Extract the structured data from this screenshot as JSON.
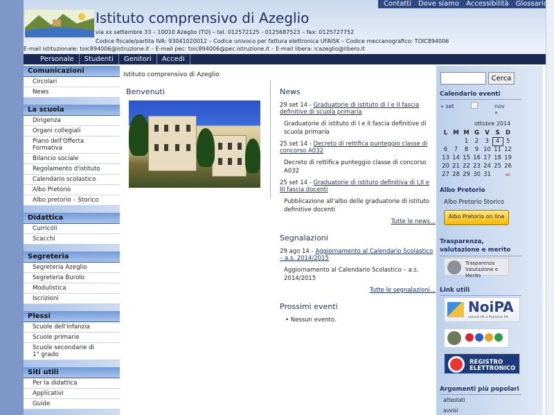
{
  "header": {
    "toplinks": [
      "Contatti",
      "Dove siamo",
      "Accessibilità",
      "Glossario"
    ],
    "title": "Istituto comprensivo di Azeglio",
    "address": "via xx settembre 33 – 10010 Azeglio (TO)   –  tel. 012572125 - 0125687523  –  fax: 0125727752",
    "codes": "Codice fiscale/partita IVA:  93041020012   –  Codice univoco per fattura elettronica UFAI5K   –  Codice meccanografico:  TOIC894006",
    "emails": "E-mail istituzionale: toic894006@istruzione.it   –  E-mail pec: toic894006@pec.istruzione.it  –  E-mail libera: icazeglio@libero.it"
  },
  "nav": [
    "Personale",
    "Studenti",
    "Genitori",
    "Accedi"
  ],
  "sidebar": [
    {
      "title": "Comunicazioni",
      "items": [
        "Circolari",
        "News"
      ]
    },
    {
      "title": "La scuola",
      "items": [
        "Dirigenza",
        "Organi collegiali",
        "Piano dell'Offerta Formativa",
        "Bilancio sociale",
        "Regolamento d'istituto",
        "Calendario scolastico",
        "Albo Pretorio",
        "Albo pretorio – Storico"
      ]
    },
    {
      "title": "Didattica",
      "items": [
        "Curricoli",
        "Scacchi"
      ]
    },
    {
      "title": "Segreteria",
      "items": [
        "Segreteria Azeglio",
        "Segreteria Burolo",
        "Modulistica",
        "Iscrizioni"
      ]
    },
    {
      "title": "Plessi",
      "items": [
        "Scuole dell'infanzia",
        "Scuole primarie",
        "Scuole secondarie di 1° grado"
      ]
    },
    {
      "title": "Siti utili",
      "items": [
        "Per la didattica",
        "Applicativi",
        "Guide"
      ]
    }
  ],
  "main": {
    "breadcrumb": "Istituto comprensivo di Azeglio",
    "welcome_title": "Benvenuti",
    "news_title": "News",
    "news": [
      {
        "date": "29 set 14 - ",
        "link": "Graduatorie di istituto di I e II fascia definitive di scuola primaria",
        "desc": "Graduatorie di istituto di I e II fascia definitive di scuola primaria"
      },
      {
        "date": "25 set 14 - ",
        "link": "Decreto di rettifica punteggio classe di concorso A032",
        "desc": "Decreto di rettifica punteggio classe di concorso A032"
      },
      {
        "date": "25 set 14 - ",
        "link": "Graduatorie di istituto definitiva di I,II e III fascia docenti",
        "desc": "Pubblicazione all'albo delle graduatorie di istituto definitive docenti"
      }
    ],
    "news_more": "Tutte le news...",
    "reports_title": "Segnalazioni",
    "reports": [
      {
        "date": "29 ago 14 - ",
        "link": "Aggiornamento al Calendario Scolastico – a.s. 2014/2015",
        "desc": "Aggiornamento al Calendario Scolastico – a.s. 2014/2015"
      }
    ],
    "reports_more": "Tutte le segnalazioni...",
    "events_title": "Prossimi eventi",
    "events_none": "Nessun evento."
  },
  "right": {
    "search_button": "Cerca",
    "calendar_title": "Calendario eventi",
    "cal_prev": "« set",
    "cal_next": "nov »",
    "cal_month": "ottobre 2014",
    "cal_days": [
      "L",
      "M",
      "M",
      "G",
      "V",
      "S",
      "D"
    ],
    "cal_weeks": [
      [
        "",
        "",
        "1",
        "2",
        "3",
        "4",
        "5"
      ],
      [
        "6",
        "7",
        "8",
        "9",
        "10",
        "11",
        "12"
      ],
      [
        "13",
        "14",
        "15",
        "16",
        "17",
        "18",
        "19"
      ],
      [
        "20",
        "21",
        "22",
        "23",
        "24",
        "25",
        "26"
      ],
      [
        "27",
        "28",
        "29",
        "30",
        "31",
        "",
        "ec"
      ]
    ],
    "cal_today": "4",
    "albo_title": "Albo Pretorio",
    "albo_storico": "Albo Pretorio Storico",
    "albo_button": "Albo Pretorio on line",
    "trasp_title": "Trasparenza, valutazione e merito",
    "trasp_text": "Trasparenza Valutazione e Merito",
    "links_title": "Link utili",
    "noipa": "NoiPA",
    "noipa_sub": "servizi PA a Persone PA",
    "reg_text": "REGISTRO ELETTRONICO",
    "popular_title": "Argomenti più popolari",
    "popular": [
      "attestati",
      "avvisi"
    ]
  }
}
